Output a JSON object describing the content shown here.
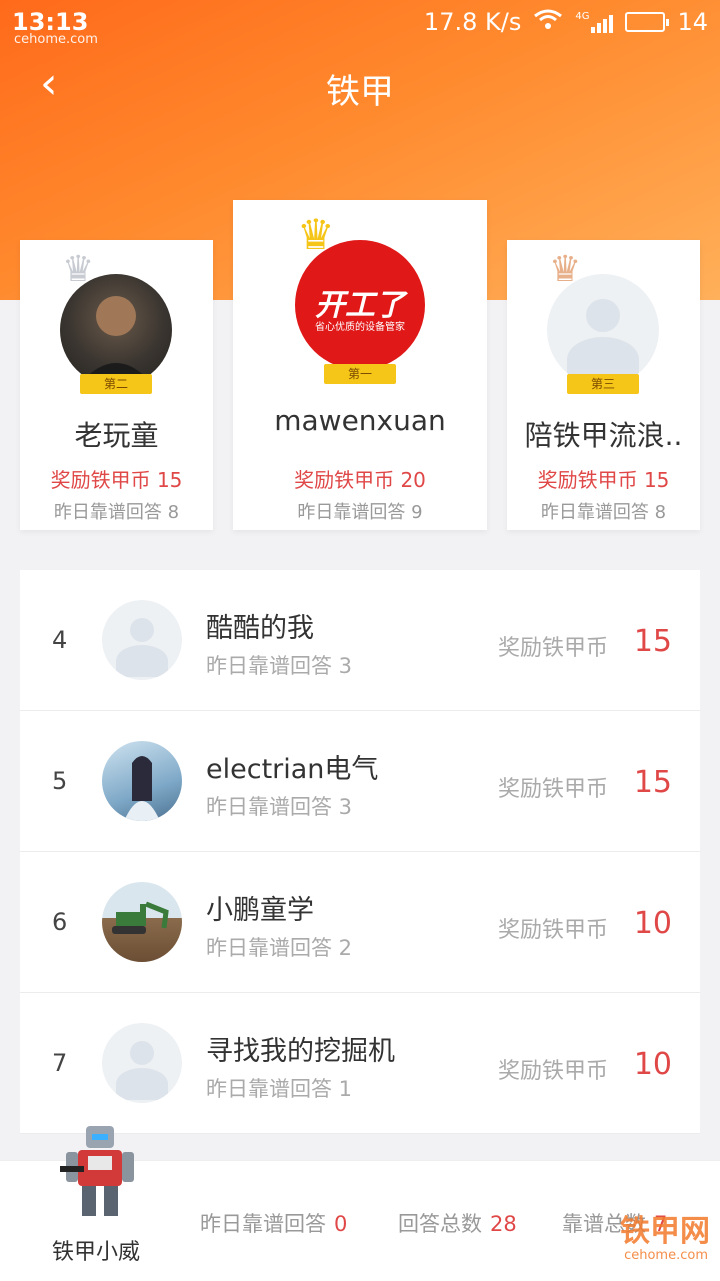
{
  "status": {
    "time": "13:13",
    "watermark_small": "cehome.com",
    "speed": "17.8 K/s",
    "network": "4G",
    "battery": "14"
  },
  "header": {
    "title": "铁甲",
    "back": "‹"
  },
  "podium": {
    "first": {
      "name": "mawenxuan",
      "rank_label": "第一",
      "reward_label": "奖励铁甲币",
      "reward": "20",
      "yday_label": "昨日靠谱回答",
      "yday": "9",
      "logo_text": "开工了",
      "logo_sub": "省心优质的设备管家"
    },
    "second": {
      "name": "老玩童",
      "rank_label": "第二",
      "reward_label": "奖励铁甲币",
      "reward": "15",
      "yday_label": "昨日靠谱回答",
      "yday": "8"
    },
    "third": {
      "name": "陪铁甲流浪..",
      "rank_label": "第三",
      "reward_label": "奖励铁甲币",
      "reward": "15",
      "yday_label": "昨日靠谱回答",
      "yday": "8"
    }
  },
  "list": [
    {
      "rank": "4",
      "name": "酷酷的我",
      "sub": "昨日靠谱回答  3",
      "reward_label": "奖励铁甲币",
      "reward": "15"
    },
    {
      "rank": "5",
      "name": "electrian电气",
      "sub": "昨日靠谱回答  3",
      "reward_label": "奖励铁甲币",
      "reward": "15"
    },
    {
      "rank": "6",
      "name": "小鹏童学",
      "sub": "昨日靠谱回答  2",
      "reward_label": "奖励铁甲币",
      "reward": "10"
    },
    {
      "rank": "7",
      "name": "寻找我的挖掘机",
      "sub": "昨日靠谱回答  1",
      "reward_label": "奖励铁甲币",
      "reward": "10"
    }
  ],
  "me": {
    "name": "铁甲小威",
    "yday_label": "昨日靠谱回答",
    "yday": "0",
    "answers_label": "回答总数",
    "answers": "28",
    "reliable_label": "靠谱总数",
    "reliable": "7"
  },
  "watermark": {
    "main": "铁甲网",
    "sub": "cehome.com"
  },
  "colors": {
    "accent": "#ff7a22",
    "red": "#e04848",
    "gold": "#f5c518"
  }
}
